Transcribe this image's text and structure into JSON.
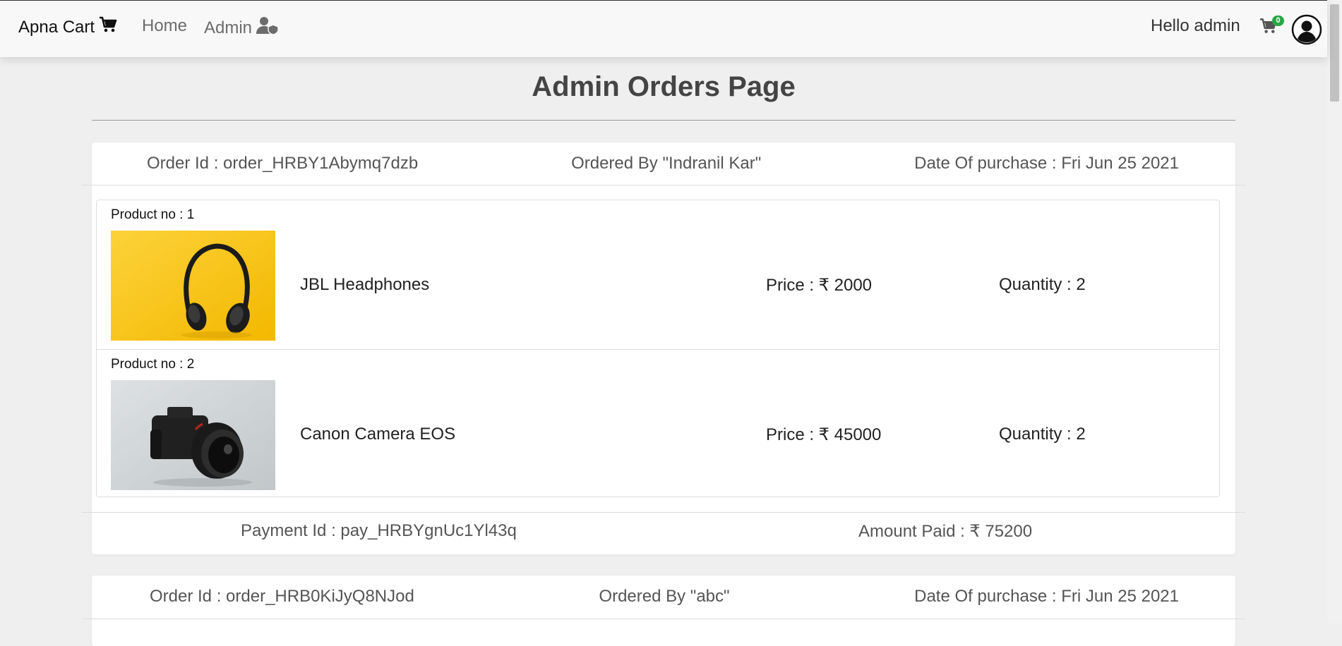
{
  "navbar": {
    "brand": "Apna Cart",
    "home": "Home",
    "admin": "Admin",
    "greeting": "Hello admin",
    "cart_count": "0"
  },
  "page": {
    "title": "Admin Orders Page"
  },
  "orders": [
    {
      "order_id": "Order Id : order_HRBY1Abymq7dzb",
      "ordered_by": "Ordered By \"Indranil Kar\"",
      "date": "Date Of purchase : Fri Jun 25 2021",
      "products": [
        {
          "no": "Product no : 1",
          "name": "JBL Headphones",
          "price": "Price : ₹ 2000",
          "quantity": "Quantity : 2",
          "image": "headphones-photo"
        },
        {
          "no": "Product no : 2",
          "name": "Canon Camera EOS",
          "price": "Price : ₹ 45000",
          "quantity": "Quantity : 2",
          "image": "camera-photo"
        }
      ],
      "payment_id": "Payment Id : pay_HRBYgnUc1Yl43q",
      "amount_paid": "Amount Paid : ₹ 75200"
    },
    {
      "order_id": "Order Id : order_HRB0KiJyQ8NJod",
      "ordered_by": "Ordered By \"abc\"",
      "date": "Date Of purchase : Fri Jun 25 2021"
    }
  ],
  "colors": {
    "badge": "#28a745",
    "background": "#efefef",
    "navbar": "#f8f8f8"
  }
}
